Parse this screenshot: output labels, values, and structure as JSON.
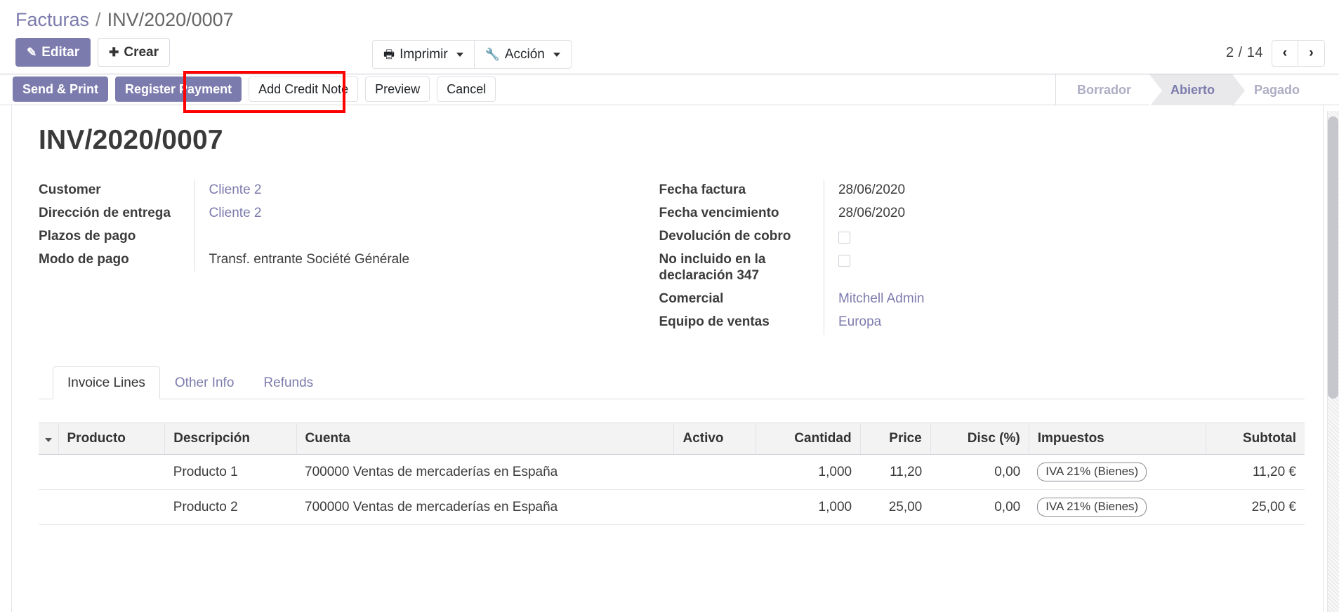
{
  "breadcrumb": {
    "root": "Facturas",
    "separator": "/",
    "current": "INV/2020/0007"
  },
  "control_panel": {
    "edit_label": "Editar",
    "create_label": "Crear",
    "print_label": "Imprimir",
    "action_label": "Acción",
    "edit_icon": "pencil-icon",
    "create_icon": "plus-icon",
    "print_icon": "printer-icon",
    "action_icon": "wrench-icon",
    "pager": {
      "text": "2 / 14",
      "current": 2,
      "total": 14,
      "prev_icon": "chevron-left-icon",
      "next_icon": "chevron-right-icon",
      "prev_glyph": "‹",
      "next_glyph": "›"
    }
  },
  "statusbar": {
    "buttons": [
      {
        "label": "Send & Print",
        "style": "primary"
      },
      {
        "label": "Register Payment",
        "style": "primary"
      },
      {
        "label": "Add Credit Note",
        "style": "plain"
      },
      {
        "label": "Preview",
        "style": "plain"
      },
      {
        "label": "Cancel",
        "style": "plain"
      }
    ],
    "stages": [
      {
        "label": "Borrador",
        "active": false
      },
      {
        "label": "Abierto",
        "active": true
      },
      {
        "label": "Pagado",
        "active": false
      }
    ]
  },
  "sheet": {
    "title": "INV/2020/0007",
    "left_fields": [
      {
        "label": "Customer",
        "value": "Cliente 2",
        "type": "link"
      },
      {
        "label": "Dirección de entrega",
        "value": "Cliente 2",
        "type": "link"
      },
      {
        "label": "Plazos de pago",
        "value": "",
        "type": "text"
      },
      {
        "label": "Modo de pago",
        "value": "Transf. entrante Société Générale",
        "type": "text"
      }
    ],
    "right_fields": [
      {
        "label": "Fecha factura",
        "value": "28/06/2020",
        "type": "text"
      },
      {
        "label": "Fecha vencimiento",
        "value": "28/06/2020",
        "type": "text"
      },
      {
        "label": "Devolución de cobro",
        "value": "",
        "type": "checkbox",
        "checked": false
      },
      {
        "label": "No incluido en la declaración 347",
        "value": "",
        "type": "checkbox",
        "checked": false
      },
      {
        "label": "Comercial",
        "value": "Mitchell Admin",
        "type": "link"
      },
      {
        "label": "Equipo de ventas",
        "value": "Europa",
        "type": "link"
      }
    ]
  },
  "notebook": {
    "tabs": [
      {
        "label": "Invoice Lines",
        "active": true
      },
      {
        "label": "Other Info",
        "active": false
      },
      {
        "label": "Refunds",
        "active": false
      }
    ]
  },
  "lines_table": {
    "columns": [
      "Producto",
      "Descripción",
      "Cuenta",
      "Activo",
      "Cantidad",
      "Price",
      "Disc (%)",
      "Impuestos",
      "Subtotal"
    ],
    "rows": [
      {
        "producto": "",
        "descripcion": "Producto 1",
        "cuenta": "700000 Ventas de mercaderías en España",
        "activo": "",
        "cantidad": "1,000",
        "price": "11,20",
        "disc": "0,00",
        "impuestos": "IVA 21% (Bienes)",
        "subtotal": "11,20 €"
      },
      {
        "producto": "",
        "descripcion": "Producto 2",
        "cuenta": "700000 Ventas de mercaderías en España",
        "activo": "",
        "cantidad": "1,000",
        "price": "25,00",
        "disc": "0,00",
        "impuestos": "IVA 21% (Bienes)",
        "subtotal": "25,00 €"
      }
    ]
  },
  "annotation": {
    "type": "highlight-rectangle",
    "color": "#FE0000",
    "targets": "Add Credit Note"
  },
  "colors": {
    "accent": "#7C7BAD",
    "stage_active_bg": "#E9E9EC",
    "stage_inactive_text": "#ADADC4",
    "annotation_red": "#FE0000",
    "table_header_bg": "#F3F3F4"
  }
}
